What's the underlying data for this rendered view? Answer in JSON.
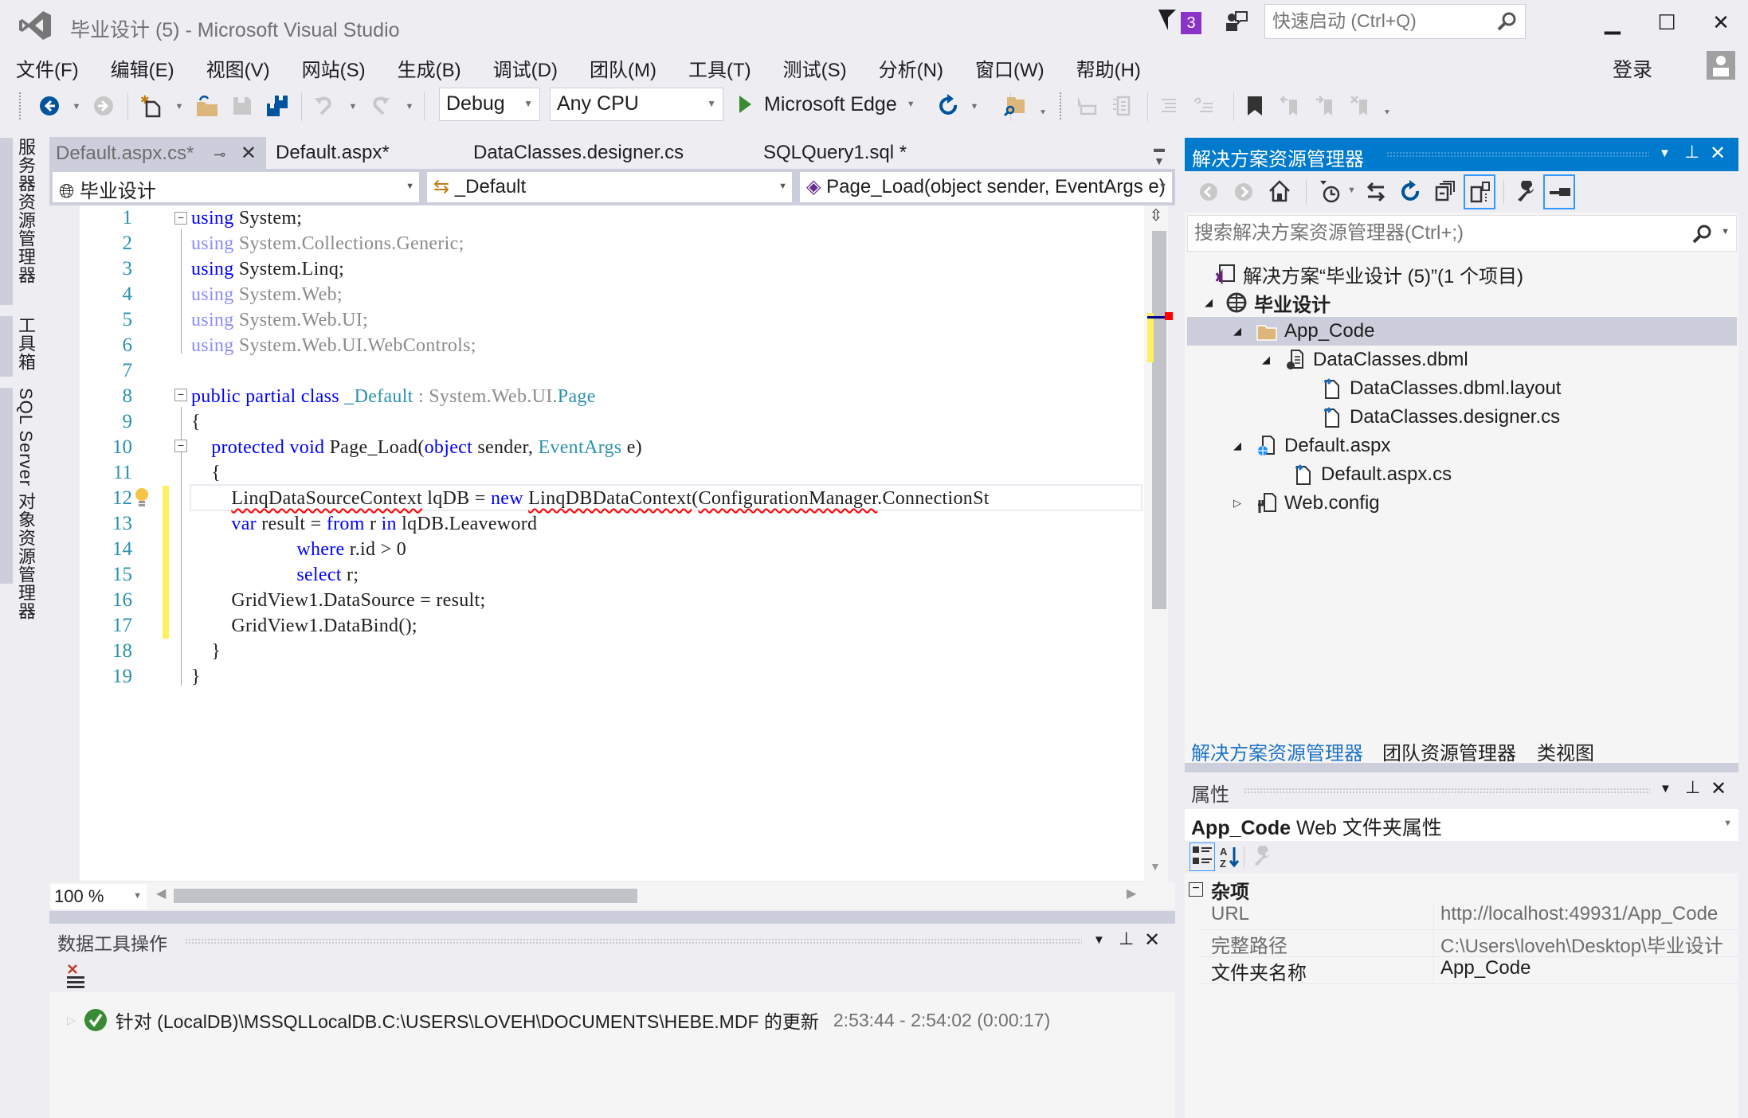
{
  "window": {
    "title": "毕业设计 (5) - Microsoft Visual Studio",
    "notification_count": "3",
    "quick_launch_placeholder": "快速启动 (Ctrl+Q)",
    "login": "登录",
    "min_glyph": "▁",
    "max_glyph": "☐",
    "close_glyph": "✕"
  },
  "menu": [
    {
      "label": "文件(F)"
    },
    {
      "label": "编辑(E)"
    },
    {
      "label": "视图(V)"
    },
    {
      "label": "网站(S)"
    },
    {
      "label": "生成(B)"
    },
    {
      "label": "调试(D)"
    },
    {
      "label": "团队(M)"
    },
    {
      "label": "工具(T)"
    },
    {
      "label": "测试(S)"
    },
    {
      "label": "分析(N)"
    },
    {
      "label": "窗口(W)"
    },
    {
      "label": "帮助(H)"
    }
  ],
  "toolbar": {
    "configuration": "Debug",
    "platform": "Any CPU",
    "run_target": "Microsoft Edge"
  },
  "left_strip": {
    "tabs": [
      "服务器资源管理器",
      "工具箱",
      "SQL Server 对象资源管理器"
    ]
  },
  "doc_tabs": [
    {
      "label": "Default.aspx.cs*",
      "active": true
    },
    {
      "label": "Default.aspx*",
      "active": false
    },
    {
      "label": "DataClasses.designer.cs",
      "active": false
    },
    {
      "label": "SQLQuery1.sql *",
      "active": false
    }
  ],
  "navbar": {
    "project": "毕业设计",
    "type": "_Default",
    "member": "Page_Load(object sender, EventArgs e)"
  },
  "code": {
    "lines": [
      {
        "n": "1"
      },
      {
        "n": "2"
      },
      {
        "n": "3"
      },
      {
        "n": "4"
      },
      {
        "n": "5"
      },
      {
        "n": "6"
      },
      {
        "n": "7"
      },
      {
        "n": "8"
      },
      {
        "n": "9"
      },
      {
        "n": "10"
      },
      {
        "n": "11"
      },
      {
        "n": "12"
      },
      {
        "n": "13"
      },
      {
        "n": "14"
      },
      {
        "n": "15"
      },
      {
        "n": "16"
      },
      {
        "n": "17"
      },
      {
        "n": "18"
      },
      {
        "n": "19"
      }
    ],
    "tokens": {
      "using": "using",
      "l1": "System;",
      "l2": "System.Collections.Generic;",
      "l3": "System.Linq;",
      "l4": "System.Web;",
      "l5": "System.Web.UI;",
      "l6": "System.Web.UI.WebControls;",
      "l8_kw": "public partial class",
      "l8_cls": "_Default",
      "l8_colon": " : System.Web.UI.",
      "l8_base": "Page",
      "open_brace": "{",
      "close_brace": "}",
      "l10_kw": "protected void",
      "l10_name": " Page_Load(",
      "l10_obj": "object",
      "l10_mid": " sender, ",
      "l10_type": "EventArgs",
      "l10_end": " e)",
      "l12_type": "LinqDataSourceContext",
      "l12_mid": " lqDB = ",
      "l12_new": "new",
      "l12_ctor": "LinqDBDataContext",
      "l12_paren": "(",
      "l12_cfg": "ConfigurationManager",
      "l12_rest": ".ConnectionSt",
      "l13_var": "var",
      "l13_mid": " result = ",
      "l13_from": "from",
      "l13_r": " r ",
      "l13_in": "in",
      "l13_src": " lqDB.Leaveword",
      "l14_where": "where",
      "l14_rest": " r.id > 0",
      "l15_select": "select",
      "l15_rest": " r;",
      "l16": "GridView1.DataSource = result;",
      "l17": "GridView1.DataBind();"
    }
  },
  "editor_footer": {
    "zoom": "100 %"
  },
  "data_panel": {
    "title": "数据工具操作",
    "result_text": "针对 (LocalDB)\\MSSQLLocalDB.C:\\USERS\\LOVEH\\DOCUMENTS\\HEBE.MDF 的更新",
    "result_time": "2:53:44 - 2:54:02 (0:00:17)",
    "status": "success"
  },
  "solution_explorer": {
    "title": "解决方案资源管理器",
    "search_placeholder": "搜索解决方案资源管理器(Ctrl+;)",
    "tree": [
      {
        "label": "解决方案“毕业设计 (5)”(1 个项目)",
        "level": 0,
        "icon": "solution-icon",
        "expander": ""
      },
      {
        "label": "毕业设计",
        "level": 0,
        "icon": "website-globe-icon",
        "expander": "◢",
        "bold": true
      },
      {
        "label": "App_Code",
        "level": 1,
        "icon": "folder-icon",
        "expander": "◢",
        "selected": true
      },
      {
        "label": "DataClasses.dbml",
        "level": 2,
        "icon": "dbml-file-icon",
        "expander": "◢"
      },
      {
        "label": "DataClasses.dbml.layout",
        "level": 3,
        "icon": "file-icon",
        "expander": ""
      },
      {
        "label": "DataClasses.designer.cs",
        "level": 3,
        "icon": "file-icon",
        "expander": ""
      },
      {
        "label": "Default.aspx",
        "level": 1,
        "icon": "aspx-file-icon",
        "expander": "◢"
      },
      {
        "label": "Default.aspx.cs",
        "level": 2,
        "icon": "file-icon",
        "expander": ""
      },
      {
        "label": "Web.config",
        "level": 1,
        "icon": "config-file-icon",
        "expander": "▷"
      }
    ],
    "tabs": [
      {
        "label": "解决方案资源管理器",
        "active": true
      },
      {
        "label": "团队资源管理器",
        "active": false
      },
      {
        "label": "类视图",
        "active": false
      }
    ]
  },
  "properties": {
    "title": "属性",
    "object_name": "App_Code",
    "object_type": " Web 文件夹属性",
    "category": "杂项",
    "rows": [
      {
        "name": "URL",
        "value": "http://localhost:49931/App_Code",
        "readonly": true
      },
      {
        "name": "完整路径",
        "value": "C:\\Users\\loveh\\Desktop\\毕业设计",
        "readonly": true
      },
      {
        "name": "文件夹名称",
        "value": "App_Code",
        "readonly": false
      }
    ]
  },
  "colors": {
    "accent": "#007acc",
    "keyword": "#0000ff",
    "type": "#2b91af",
    "notification": "#8b32c8",
    "success": "#388a34"
  }
}
